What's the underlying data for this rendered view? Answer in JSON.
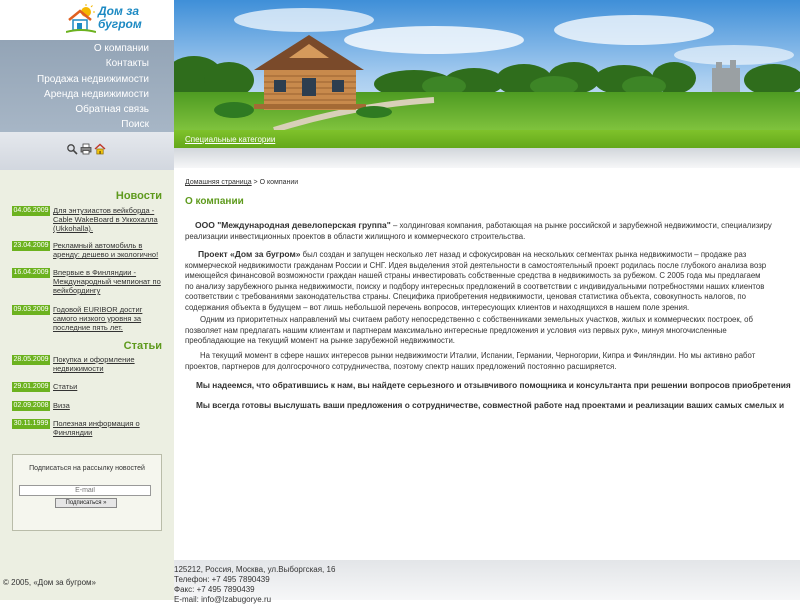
{
  "logo": {
    "line1": "Дом за",
    "line2": "бугром"
  },
  "nav": [
    {
      "label": "О компании"
    },
    {
      "label": "Контакты"
    },
    {
      "label": "Продажа недвижимости"
    },
    {
      "label": "Аренда недвижимости"
    },
    {
      "label": "Обратная связь"
    },
    {
      "label": "Поиск"
    }
  ],
  "tools": [
    "search-icon",
    "print-icon",
    "home-icon"
  ],
  "news": {
    "title": "Новости",
    "items": [
      {
        "date": "04.06.2009",
        "text": "Для энтузиастов вейкборда - Cable WakeBoard в Уккохалла (Ukkohalla)."
      },
      {
        "date": "23.04.2009",
        "text": "Рекламный автомобиль в аренду: дешево и экологично!"
      },
      {
        "date": "16.04.2009",
        "text": "Впервые в Финляндии - Международный чемпионат по вейкбордингу"
      },
      {
        "date": "09.03.2009",
        "text": "Годовой EURIBOR достиг самого низкого уровня за последние пять лет."
      }
    ]
  },
  "articles": {
    "title": "Статьи",
    "items": [
      {
        "date": "28.05.2009",
        "text": "Покупка и оформление недвижимости"
      },
      {
        "date": "29.01.2009",
        "text": "Статьи"
      },
      {
        "date": "02.09.2008",
        "text": "Виза"
      },
      {
        "date": "30.11.1999",
        "text": "Полезная информация о Финляндии"
      }
    ]
  },
  "subscribe": {
    "title": "Подписаться на рассылку новостей",
    "placeholder": "E-mail",
    "button": "Подписаться »"
  },
  "special_link": "Специальные категории",
  "breadcrumb": {
    "home": "Домашняя страница",
    "sep": " > ",
    "current": "О компании"
  },
  "page_title": "О компании",
  "content": {
    "p1_lead": "ООО \"Международная девелоперская группа\"",
    "p1_l1": " – холдинговая компания, работающая на рынке российской и зарубежной недвижимости, специализиру",
    "p1_l2": "реализации инвестиционных проектов в области жилищного и коммерческого строительства.",
    "p2_lead": "Проект «Дом за бугром»",
    "p2_l1": " был создан и запущен несколько лет назад и сфокусирован на нескольких сегментах рынка недвижимости – продаже раз",
    "p2_l2": "коммерческой недвижимости гражданам России и СНГ. Идея выделения этой деятельности в самостоятельный проект родилась после глубокого анализа возр",
    "p2_l3": "имеющейся финансовой возможности граждан нашей страны инвестировать собственные средства в недвижимость за рубежом. С 2005 года мы предлагаем",
    "p2_l4": "по анализу зарубежного рынка недвижимости, поиску и подбору интересных предложений в соответствии с индивидуальными потребностями наших клиентов",
    "p2_l5": "соответствии с требованиями законодательства страны. Специфика приобретения недвижимости, ценовая статистика объекта, совокупность налогов, по",
    "p2_l6": "содержания объекта в будущем – вот лишь небольшой перечень вопросов, интересующих клиентов и находящихся в нашем поле зрения.",
    "p3_l1": "Одним из приоритетных направлений мы считаем работу непосредственно с собственниками земельных участков, жилых и коммерческих построек, об",
    "p3_l2": "позволяет нам предлагать нашим клиентам и партнерам максимально интересные предложения и условия «из первых рук», минуя многочисленные",
    "p3_l3": "преобладающие на текущий момент на рынке зарубежной недвижимости.",
    "p4_l1": "На текущий момент в сфере наших интересов рынки недвижимости Италии, Испании, Германии, Черногории, Кипра и Финляндии. Но мы активно работ",
    "p4_l2": "проектов, партнеров для долгосрочного сотрудничества, поэтому спектр наших предложений постоянно расширяется.",
    "p5": "Мы надеемся, что обратившись к нам, вы найдете серьезного и отзывчивого помощника и консультанта при решении вопросов приобретения",
    "p6": "Мы всегда готовы выслушать ваши предложения о сотрудничестве, совместной работе над проектами и реализации ваших самых смелых и"
  },
  "footer": {
    "copyright": "© 2005, «Дом за бугром»",
    "address": "125212, Россия, Москва, ул.Выборгская, 16",
    "phone": "Телефон: +7 495 7890439",
    "fax": "Факс: +7 495 7890439",
    "email": "E-mail: info@Izabugorye.ru"
  },
  "colors": {
    "accent": "#5e9a1d",
    "nav_bg": "#a0b0c1",
    "green_bar": "#6cb21f",
    "sidebar_bg": "#ecefe2"
  }
}
